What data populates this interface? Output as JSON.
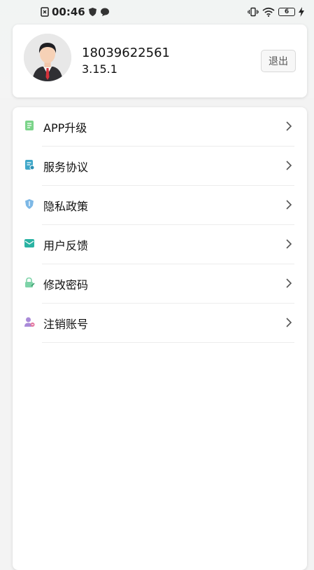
{
  "status_bar": {
    "time": "00:46",
    "battery": "6"
  },
  "profile": {
    "phone": "18039622561",
    "version": "3.15.1",
    "logout_label": "退出"
  },
  "menu": {
    "items": [
      {
        "label": "APP升级",
        "icon": "document-icon",
        "color": "#7bd48a"
      },
      {
        "label": "服务协议",
        "icon": "contract-icon",
        "color": "#3fa7c9"
      },
      {
        "label": "隐私政策",
        "icon": "shield-icon",
        "color": "#7db8e6"
      },
      {
        "label": "用户反馈",
        "icon": "feedback-mail-icon",
        "color": "#2ab3a3"
      },
      {
        "label": "修改密码",
        "icon": "lock-edit-icon",
        "color": "#7ed3a8"
      },
      {
        "label": "注销账号",
        "icon": "user-remove-icon",
        "color": "#a98ad8"
      }
    ]
  }
}
